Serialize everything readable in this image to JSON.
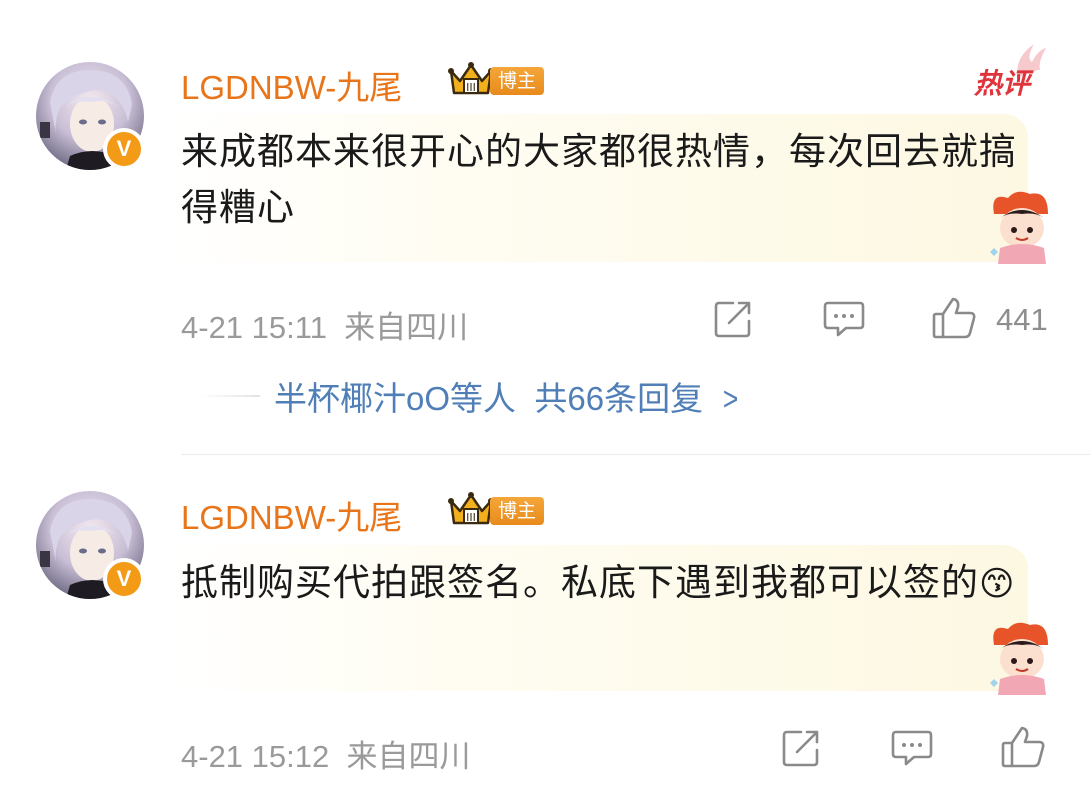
{
  "comments": [
    {
      "username": "LGDNBW-九尾",
      "role_badge": "博主",
      "hot_tag": "热评",
      "text": "来成都本来很开心的大家都很热情，每次回去就搞得糟心",
      "time": "4-21 15:11",
      "location": "来自四川",
      "likes": "441",
      "replies": {
        "names": "半杯椰汁oO等人",
        "count_text": "共66条回复",
        "arrow": ">"
      }
    },
    {
      "username": "LGDNBW-九尾",
      "role_badge": "博主",
      "text": "抵制购买代拍跟签名。私底下遇到我都可以签的",
      "emoji": "😙",
      "time": "4-21 15:12",
      "location": "来自四川"
    }
  ],
  "colors": {
    "username": "#e8751a",
    "link": "#4f7fb6",
    "meta": "#9a9a9a",
    "hot": "#e0343c",
    "vip_badge": "#f39a17"
  },
  "icons": {
    "share": "share-icon",
    "comment": "comment-icon",
    "like": "thumbs-up-icon",
    "crown": "crown-icon",
    "verified": "verified-v-icon"
  }
}
